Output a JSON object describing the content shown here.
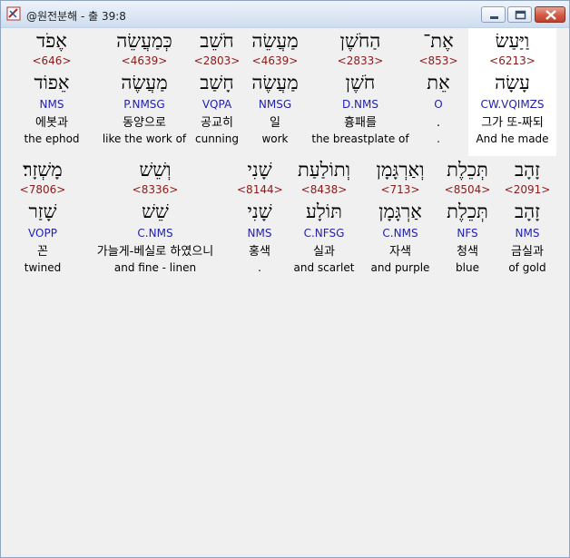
{
  "window": {
    "title": "@원전분해 - 출 39:8"
  },
  "line1": [
    {
      "heb": "אֶפֹד",
      "strong": "<646>",
      "lemma": "אֵפוֹד",
      "parse": "NMS",
      "kor": "에봇과",
      "eng": "the ephod"
    },
    {
      "heb": "כְּמַעֲשֵׂה",
      "strong": "<4639>",
      "lemma": "מַעֲשֶׂה",
      "parse": "P.NMSG",
      "kor": "동양으로",
      "eng": "like the work of"
    },
    {
      "heb": "חֹשֵׁב",
      "strong": "<2803>",
      "lemma": "חָשַׁב",
      "parse": "VQPA",
      "kor": "공교히",
      "eng": "cunning"
    },
    {
      "heb": "מַעֲשֵׂה",
      "strong": "<4639>",
      "lemma": "מַעֲשֶׂה",
      "parse": "NMSG",
      "kor": "일",
      "eng": "work"
    },
    {
      "heb": "הַחֹשֶׁן",
      "strong": "<2833>",
      "lemma": "חֹשֶׁן",
      "parse": "D.NMS",
      "kor": "흉패를",
      "eng": "the breastplate of"
    },
    {
      "heb": "אֶת־",
      "strong": "<853>",
      "lemma": "אֵת",
      "parse": "O",
      "kor": ".",
      "eng": "."
    },
    {
      "heb": "וַיַּעַשׂ",
      "strong": "<6213>",
      "lemma": "עָשָׂה",
      "parse": "CW.VQIMZS",
      "kor": "그가 또-짜되",
      "eng": "And he made"
    }
  ],
  "line2": [
    {
      "heb": "מָשְׁזָר׃",
      "strong": "<7806>",
      "lemma": "שָׁזַר",
      "parse": "VOPP",
      "kor": "꼰",
      "eng": "twined"
    },
    {
      "heb": "וְשֵׁשׁ",
      "strong": "<8336>",
      "lemma": "שֵׁשׁ",
      "parse": "C.NMS",
      "kor": "가늘게-베실로 하였으니",
      "eng": "and fine - linen"
    },
    {
      "heb": "שָׁנִי",
      "strong": "<8144>",
      "lemma": "שָׁנִי",
      "parse": "NMS",
      "kor": "홍색",
      "eng": "."
    },
    {
      "heb": "וְתוֹלַעַת",
      "strong": "<8438>",
      "lemma": "תּוֹלָע",
      "parse": "C.NFSG",
      "kor": "실과",
      "eng": "and scarlet"
    },
    {
      "heb": "וְאַרְגָּמָן",
      "strong": "<713>",
      "lemma": "אַרְגָּמָן",
      "parse": "C.NMS",
      "kor": "자색",
      "eng": "and purple"
    },
    {
      "heb": "תְּכֵלֶת",
      "strong": "<8504>",
      "lemma": "תְּכֵלֶת",
      "parse": "NFS",
      "kor": "청색",
      "eng": "blue"
    },
    {
      "heb": "זָהָב",
      "strong": "<2091>",
      "lemma": "זָהָב",
      "parse": "NMS",
      "kor": "금실과",
      "eng": "of gold"
    }
  ]
}
